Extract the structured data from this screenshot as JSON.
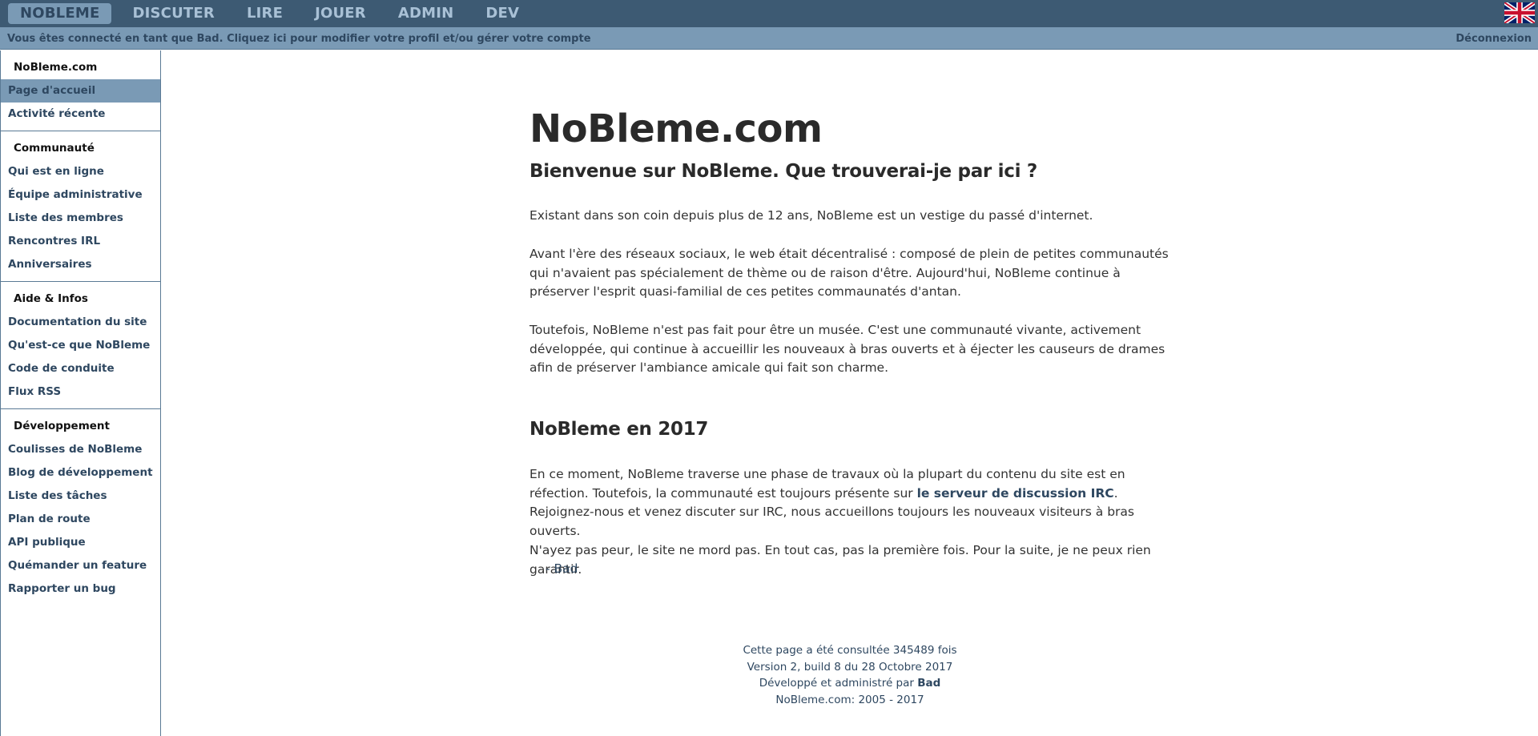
{
  "nav": {
    "items": [
      "NOBLEME",
      "DISCUTER",
      "LIRE",
      "JOUER",
      "ADMIN",
      "DEV"
    ],
    "active_index": 0,
    "language_flag": "uk-flag-icon"
  },
  "subbar": {
    "status_text": "Vous êtes connecté en tant que Bad. Cliquez ici pour modifier votre profil et/ou gérer votre compte",
    "logout_label": "Déconnexion"
  },
  "sidebar": {
    "sections": [
      {
        "heading": "NoBleme.com",
        "links": [
          "Page d'accueil",
          "Activité récente"
        ],
        "active_index": 0
      },
      {
        "heading": "Communauté",
        "links": [
          "Qui est en ligne",
          "Équipe administrative",
          "Liste des membres",
          "Rencontres IRL",
          "Anniversaires"
        ]
      },
      {
        "heading": "Aide & Infos",
        "links": [
          "Documentation du site",
          "Qu'est-ce que NoBleme",
          "Code de conduite",
          "Flux RSS"
        ]
      },
      {
        "heading": "Développement",
        "links": [
          "Coulisses de NoBleme",
          "Blog de développement",
          "Liste des tâches",
          "Plan de route",
          "API publique",
          "Quémander un feature",
          "Rapporter un bug"
        ]
      }
    ]
  },
  "main": {
    "title": "NoBleme.com",
    "subtitle": "Bienvenue sur NoBleme. Que trouverai-je par ici ?",
    "para1": "Existant dans son coin depuis plus de 12 ans, NoBleme est un vestige du passé d'internet.",
    "para2": "Avant l'ère des réseaux sociaux, le web était décentralisé : composé de plein de petites communautés qui n'avaient pas spécialement de thème ou de raison d'être. Aujourd'hui, NoBleme continue à préserver l'esprit quasi-familial de ces petites commaunatés d'antan.",
    "para3": "Toutefois, NoBleme n'est pas fait pour être un musée. C'est une communauté vivante, activement développée, qui continue à accueillir les nouveaux à bras ouverts et à éjecter les causeurs de drames afin de préserver l'ambiance amicale qui fait son charme.",
    "section_title": "NoBleme en 2017",
    "para4_before": "En ce moment, NoBleme traverse une phase de travaux où la plupart du contenu du site est en réfection. Toutefois, la communauté est toujours présente sur ",
    "para4_link": "le serveur de discussion IRC",
    "para4_after": ". Rejoignez-nous et venez discuter sur IRC, nous accueillons toujours les nouveaux visiteurs à bras ouverts.",
    "para5": "N'ayez pas peur, le site ne mord pas. En tout cas, pas la première fois. Pour la suite, je ne peux rien garantir.",
    "signature": "- Bad"
  },
  "footer": {
    "views": "Cette page a été consultée 345489 fois",
    "version": "Version 2, build 8 du 28 Octobre 2017",
    "dev_prefix": "Développé et administré par ",
    "dev_name": "Bad",
    "copyright": "NoBleme.com: 2005 - 2017"
  },
  "colors": {
    "nav_bg": "#3d5a73",
    "nav_text": "#a9c1d6",
    "accent": "#7a9ab5",
    "link": "#2e4760"
  }
}
